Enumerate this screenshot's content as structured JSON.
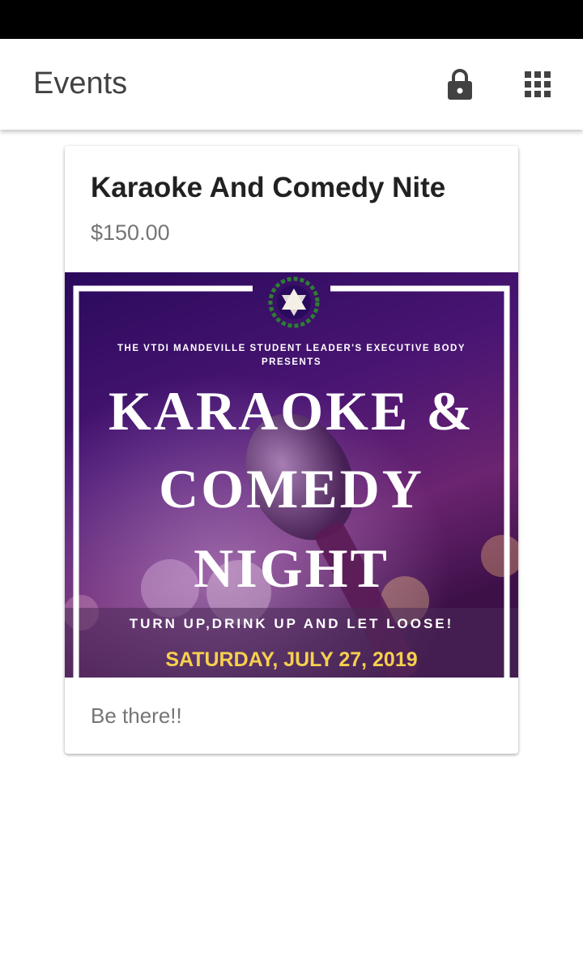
{
  "app_bar": {
    "title": "Events",
    "lock_icon": "lock-icon",
    "apps_icon": "apps-grid-icon"
  },
  "event": {
    "title": "Karaoke And Comedy Nite",
    "price": "$150.00",
    "description": "Be there!!",
    "poster": {
      "subheading": "THE VTDI MANDEVILLE STUDENT LEADER'S EXECUTIVE BODY PRESENTS",
      "headline_line1": "KARAOKE &",
      "headline_line2": "COMEDY",
      "headline_line3": "NIGHT",
      "tagline": "TURN UP,DRINK UP AND LET LOOSE!",
      "date": "SATURDAY, JULY 27, 2019",
      "colors": {
        "background": "#3a0f6e",
        "accent": "#f6d04d",
        "frame": "#ffffff",
        "emblem": "#2e7d32"
      }
    }
  },
  "colors": {
    "status_bar": "#000000",
    "app_bar": "#ffffff",
    "title_text": "#424242",
    "icon": "#424242"
  }
}
